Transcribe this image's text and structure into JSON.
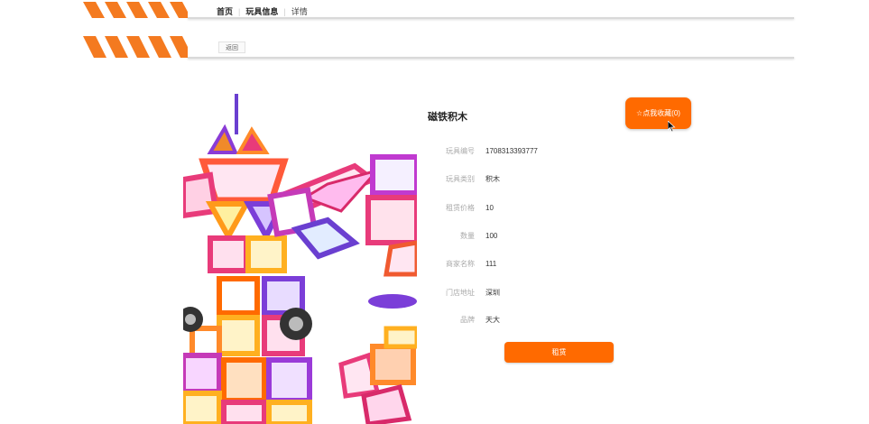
{
  "nav": {
    "breadcrumbs": [
      "首页",
      "玩具信息",
      "详情"
    ],
    "back_label": "返回"
  },
  "product": {
    "name": "磁铁积木",
    "favorite_label": "☆点我收藏(0)",
    "fields": [
      {
        "label": "玩具编号",
        "value": "1708313393777"
      },
      {
        "label": "玩具类别",
        "value": "积木"
      },
      {
        "label": "租赁价格",
        "value": "10"
      },
      {
        "label": "数量",
        "value": "100"
      },
      {
        "label": "商家名称",
        "value": "111"
      },
      {
        "label": "门店地址",
        "value": "深圳"
      },
      {
        "label": "品牌",
        "value": "天大"
      }
    ],
    "rent_label": "租赁",
    "image_icon": "toy-robot-image"
  },
  "colors": {
    "accent": "#ff6a00",
    "stripe": "#f47a20"
  }
}
